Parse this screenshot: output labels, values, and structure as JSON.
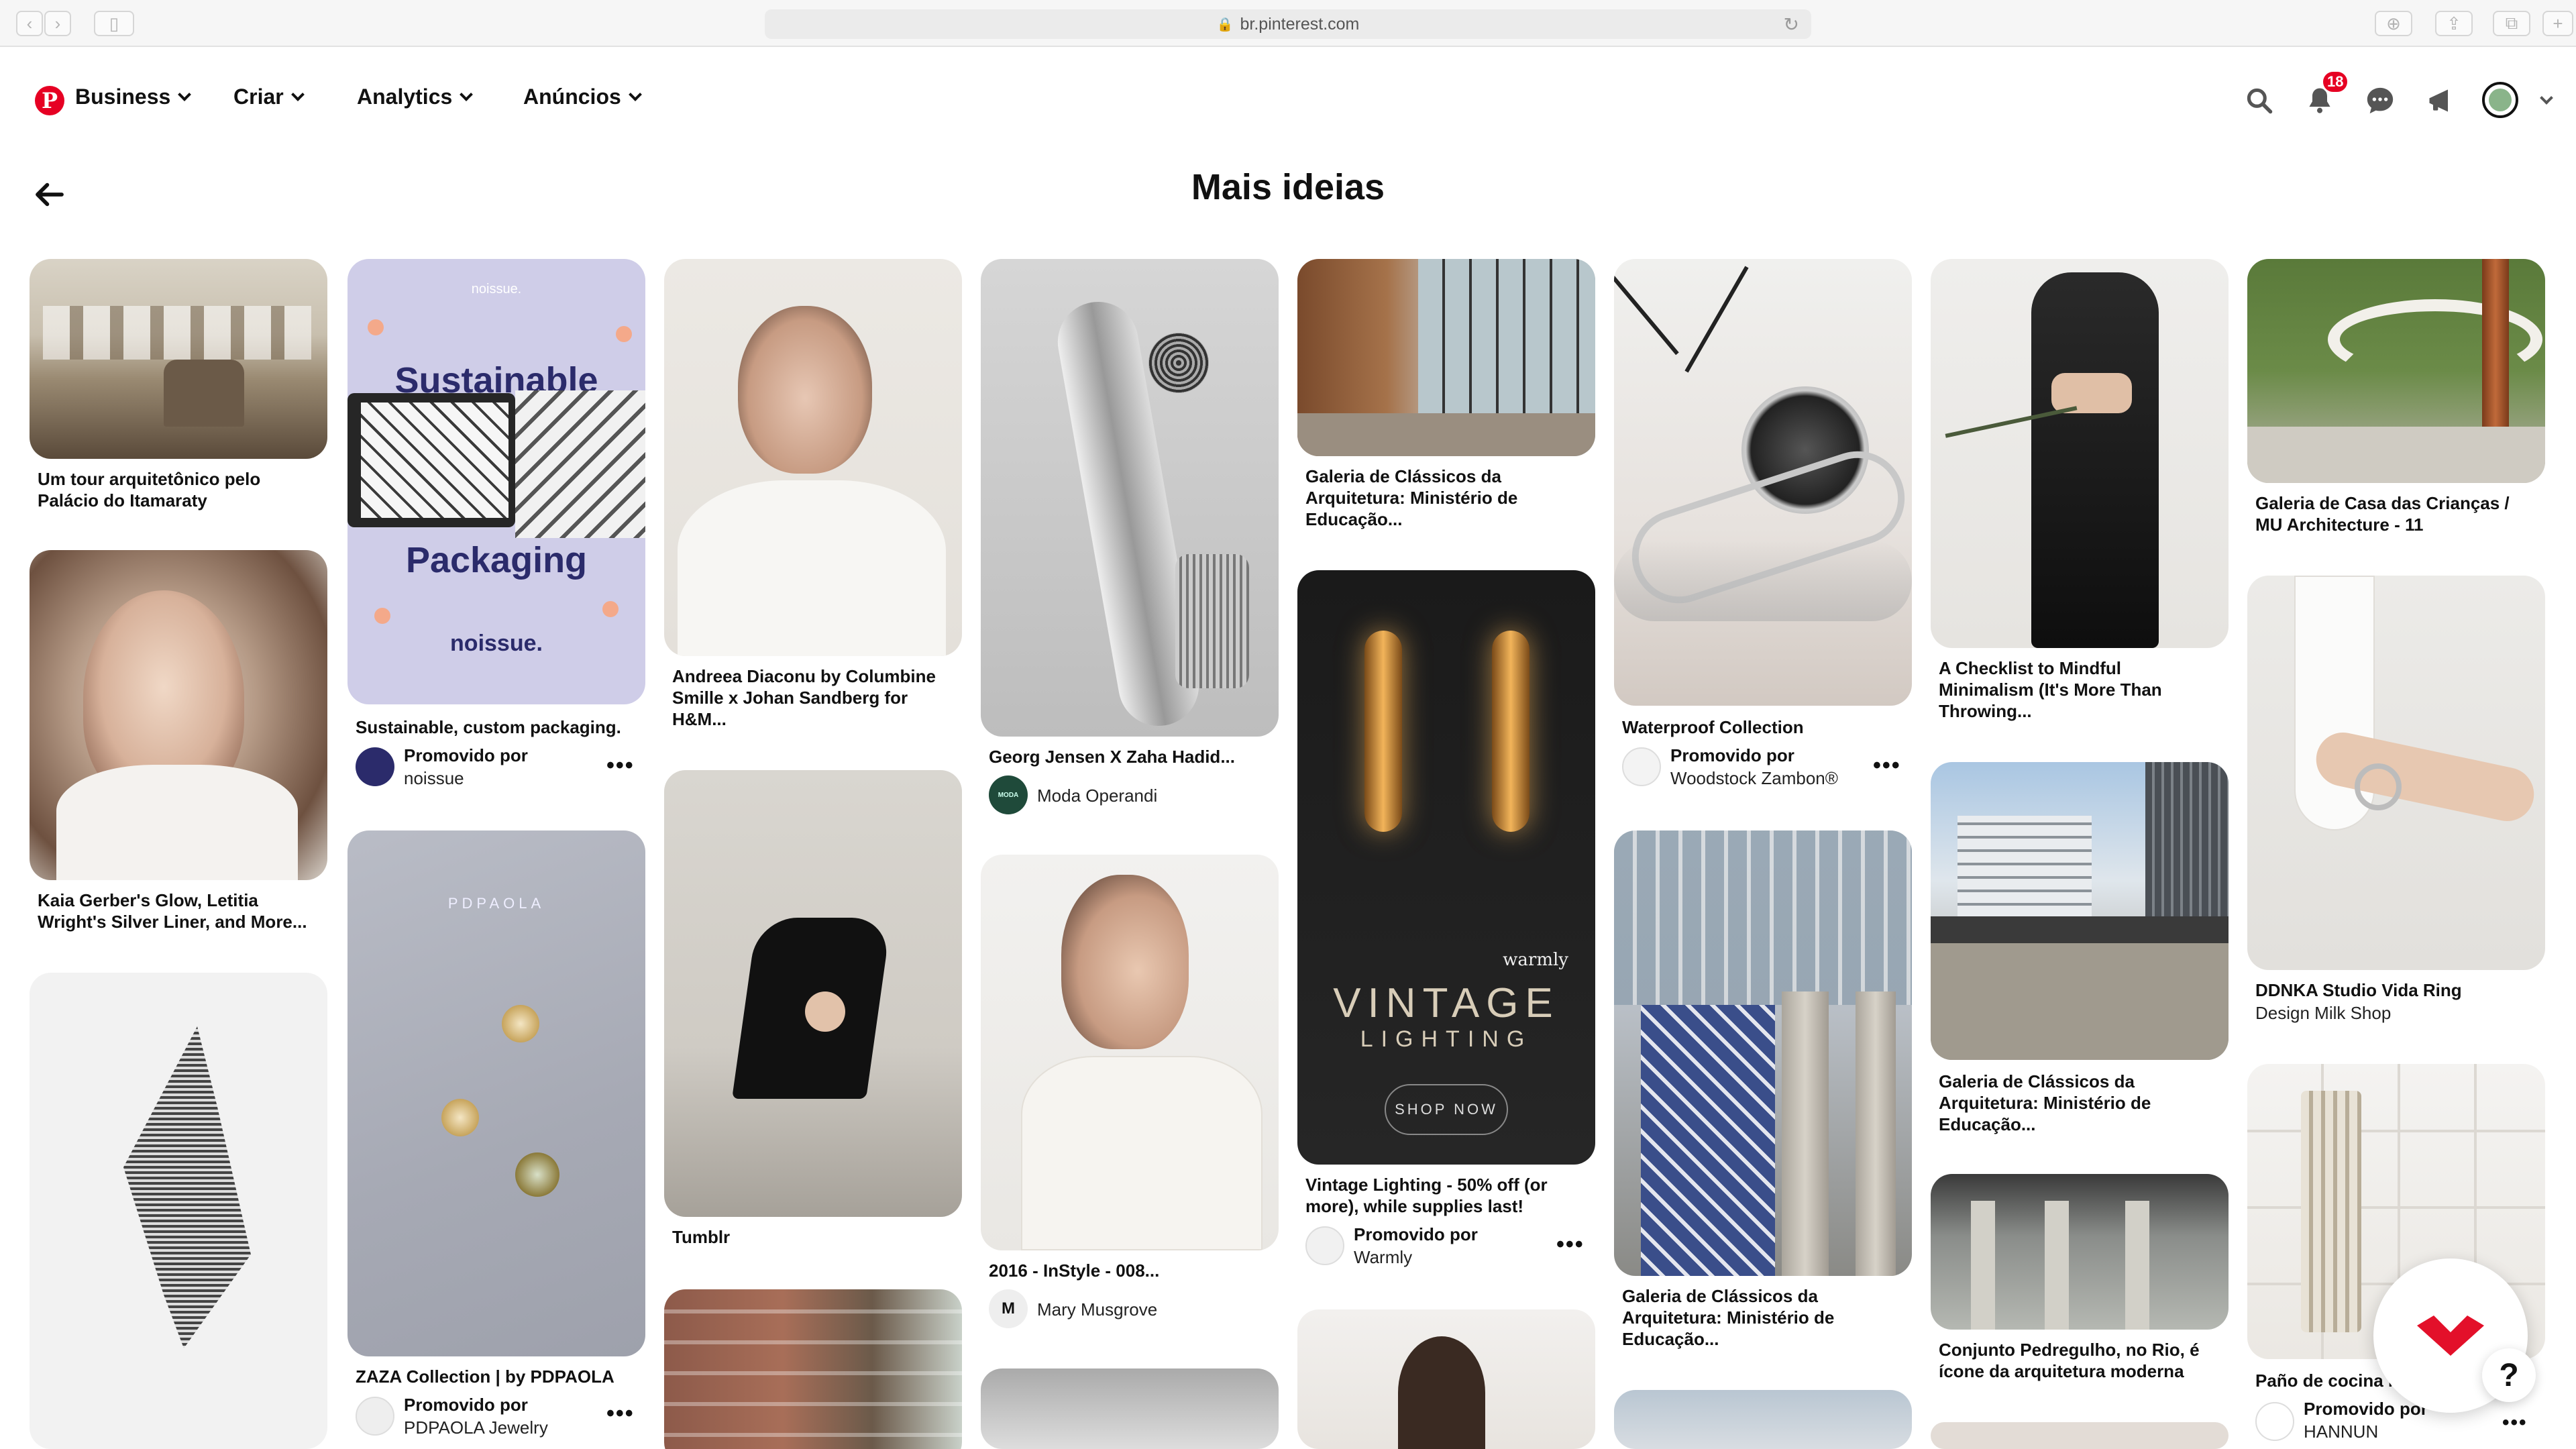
{
  "browser": {
    "url": "br.pinterest.com"
  },
  "nav": {
    "business": "Business",
    "criar": "Criar",
    "analytics": "Analytics",
    "anuncios": "Anúncios",
    "notifications_count": "18"
  },
  "page_title": "Mais ideias",
  "pins": {
    "p1": {
      "title": "Um tour arquitetônico pelo Palácio do Itamaraty"
    },
    "p2": {
      "title": "Kaia Gerber's Glow, Letitia Wright's Silver Liner, and More..."
    },
    "p3": {
      "title": "Sustainable, custom packaging.",
      "promo_label": "Promovido por",
      "brand": "noissue",
      "img_top": "noissue.",
      "img_line1": "Sustainable",
      "img_line2": "Packaging",
      "img_bottom": "noissue."
    },
    "p4": {
      "title": "ZAZA Collection | by PDPAOLA",
      "promo_label": "Promovido por",
      "brand": "PDPAOLA Jewelry",
      "img_brand": "PDPAOLA"
    },
    "p5": {
      "title": "Andreea Diaconu by Columbine Smille x Johan Sandberg for H&M..."
    },
    "p6": {
      "title": "Tumblr"
    },
    "p7": {
      "title": "Georg Jensen X Zaha Hadid...",
      "creator": "Moda Operandi",
      "creator_initial": "MODA"
    },
    "p8": {
      "title": "2016 - InStyle - 008...",
      "creator": "Mary Musgrove",
      "creator_initial": "M"
    },
    "p9": {
      "title": "Galeria de Clássicos da Arquitetura: Ministério de Educação..."
    },
    "p10": {
      "title": "Vintage Lighting - 50% off (or more), while supplies last!",
      "promo_label": "Promovido por",
      "brand": "Warmly",
      "img_brand": "warmly",
      "img_line1": "VINTAGE",
      "img_line2": "LIGHTING",
      "img_cta": "SHOP NOW"
    },
    "p11": {
      "title": "Waterproof Collection",
      "promo_label": "Promovido por",
      "brand": "Woodstock Zambon®"
    },
    "p12": {
      "title": "Galeria de Clássicos da Arquitetura: Ministério de Educação..."
    },
    "p13": {
      "title": "A Checklist to Mindful Minimalism (It's More Than Throwing..."
    },
    "p14": {
      "title": "Galeria de Clássicos da Arquitetura: Ministério de Educação..."
    },
    "p15": {
      "title": "Conjunto Pedregulho, no Rio, é ícone da arquitetura moderna"
    },
    "p16": {
      "title": "Galeria de Casa das Crianças / MU Architecture - 11"
    },
    "p17": {
      "title": "DDNKA Studio Vida Ring",
      "sub": "Design Milk Shop"
    },
    "p18": {
      "title": "Paño de cocina N...",
      "promo_label": "Promovido por",
      "brand": "HANNUN"
    }
  },
  "help": {
    "label": "?"
  },
  "more_label": "•••"
}
